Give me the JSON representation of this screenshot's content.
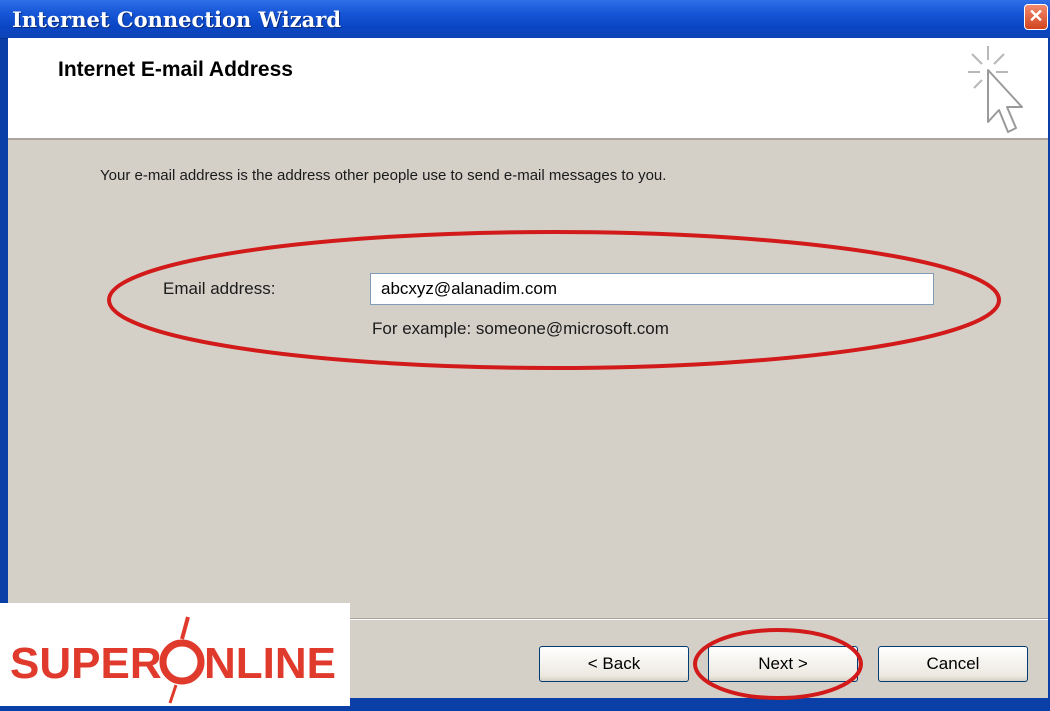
{
  "window": {
    "title": "Internet Connection Wizard",
    "close_glyph": "✕"
  },
  "header": {
    "heading": "Internet E-mail Address",
    "icon": "wizard-cursor-icon"
  },
  "body": {
    "description": "Your e-mail address is the address other people use to send e-mail messages to you.",
    "email_label": "Email address:",
    "email_value": "abcxyz@alanadim.com",
    "example_text": "For example: someone@microsoft.com"
  },
  "buttons": {
    "back": "< Back",
    "next": "Next >",
    "cancel": "Cancel"
  },
  "logo": {
    "text": "SUPERONLINE",
    "color": "#e03a2c"
  },
  "annotation_color": "#d21a1a"
}
